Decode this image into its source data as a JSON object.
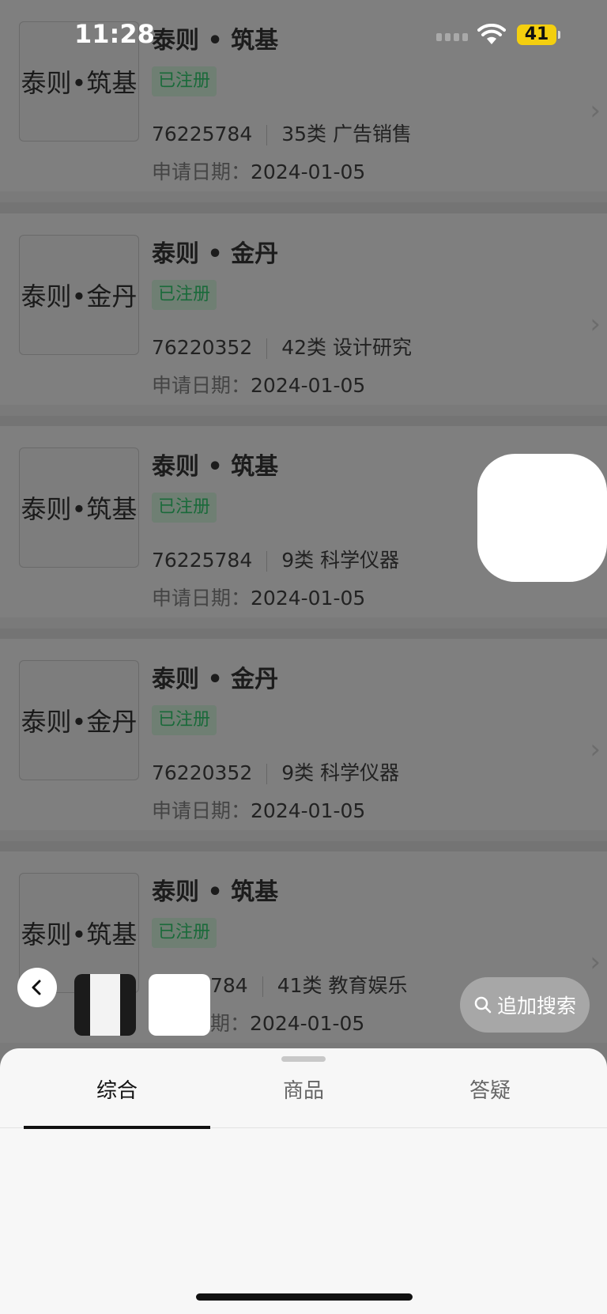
{
  "status_bar": {
    "time": "11:28",
    "battery": "41"
  },
  "results": [
    {
      "logo_text": "泰则•筑基",
      "title": "泰则 • 筑基",
      "status": "已注册",
      "reg_no": "76225784",
      "category": "35类 广告销售",
      "date_label": "申请日期：",
      "date": "2024-01-05"
    },
    {
      "logo_text": "泰则•金丹",
      "title": "泰则 • 金丹",
      "status": "已注册",
      "reg_no": "76220352",
      "category": "42类 设计研究",
      "date_label": "申请日期：",
      "date": "2024-01-05"
    },
    {
      "logo_text": "泰则•筑基",
      "title": "泰则 • 筑基",
      "status": "已注册",
      "reg_no": "76225784",
      "category": "9类 科学仪器",
      "date_label": "申请日期：",
      "date": "2024-01-05"
    },
    {
      "logo_text": "泰则•金丹",
      "title": "泰则 • 金丹",
      "status": "已注册",
      "reg_no": "76220352",
      "category": "9类 科学仪器",
      "date_label": "申请日期：",
      "date": "2024-01-05"
    },
    {
      "logo_text": "泰则•筑基",
      "title": "泰则 • 筑基",
      "status": "已注册",
      "reg_no": "784",
      "category": "41类 教育娱乐",
      "date_label": "期：",
      "date": "2024-01-05"
    }
  ],
  "bottom_bar": {
    "search_label": "追加搜索"
  },
  "sheet": {
    "tabs": [
      {
        "label": "综合",
        "active": true
      },
      {
        "label": "商品",
        "active": false
      },
      {
        "label": "答疑",
        "active": false
      }
    ]
  },
  "colors": {
    "badge_text": "#1a6a3a",
    "battery": "#f4cf0f"
  }
}
